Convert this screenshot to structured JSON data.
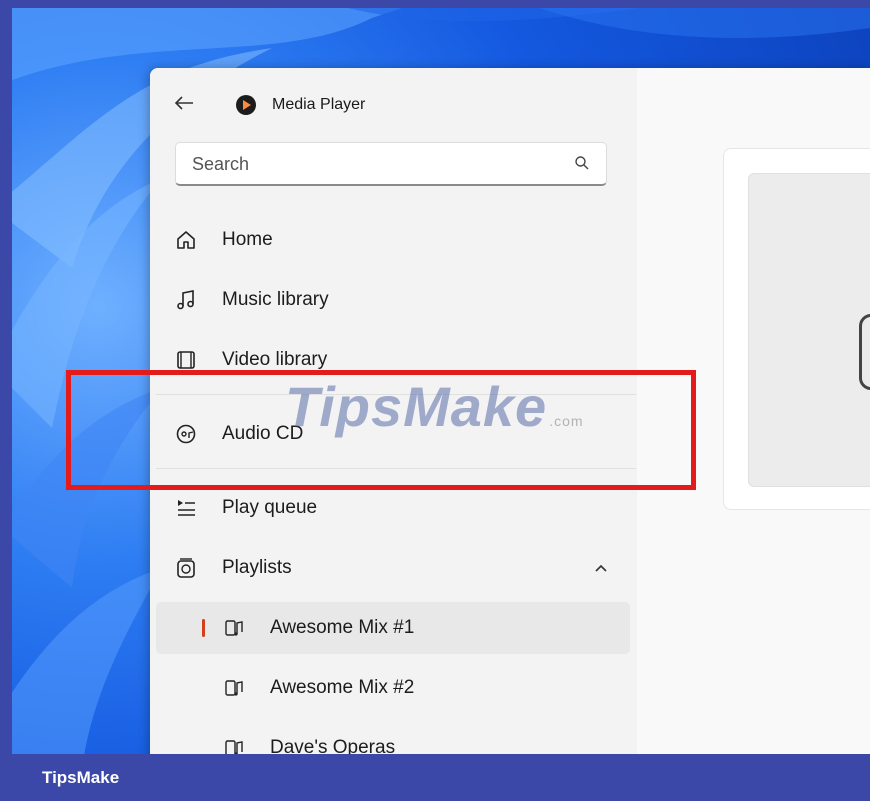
{
  "app": {
    "title": "Media Player"
  },
  "search": {
    "placeholder": "Search"
  },
  "nav": {
    "home": "Home",
    "music_library": "Music library",
    "video_library": "Video library",
    "audio_cd": "Audio CD",
    "play_queue": "Play queue",
    "playlists": "Playlists"
  },
  "playlists": [
    {
      "label": "Awesome Mix #1",
      "selected": true
    },
    {
      "label": "Awesome Mix #2",
      "selected": false
    },
    {
      "label": "Dave's Operas",
      "selected": false
    }
  ],
  "watermark": {
    "text": "TipsMake",
    "suffix": ".com"
  },
  "footer": {
    "brand": "TipsMake"
  },
  "colors": {
    "accent": "#d2401e",
    "highlight_box": "#e41b1b",
    "footer_bg": "#3b48a8"
  },
  "icons": {
    "back": "back-arrow-icon",
    "search": "search-icon",
    "home": "home-icon",
    "music": "music-note-icon",
    "video": "film-icon",
    "cd": "cd-icon",
    "queue": "queue-icon",
    "playlists": "playlist-icon",
    "chevron": "chevron-up-icon"
  }
}
